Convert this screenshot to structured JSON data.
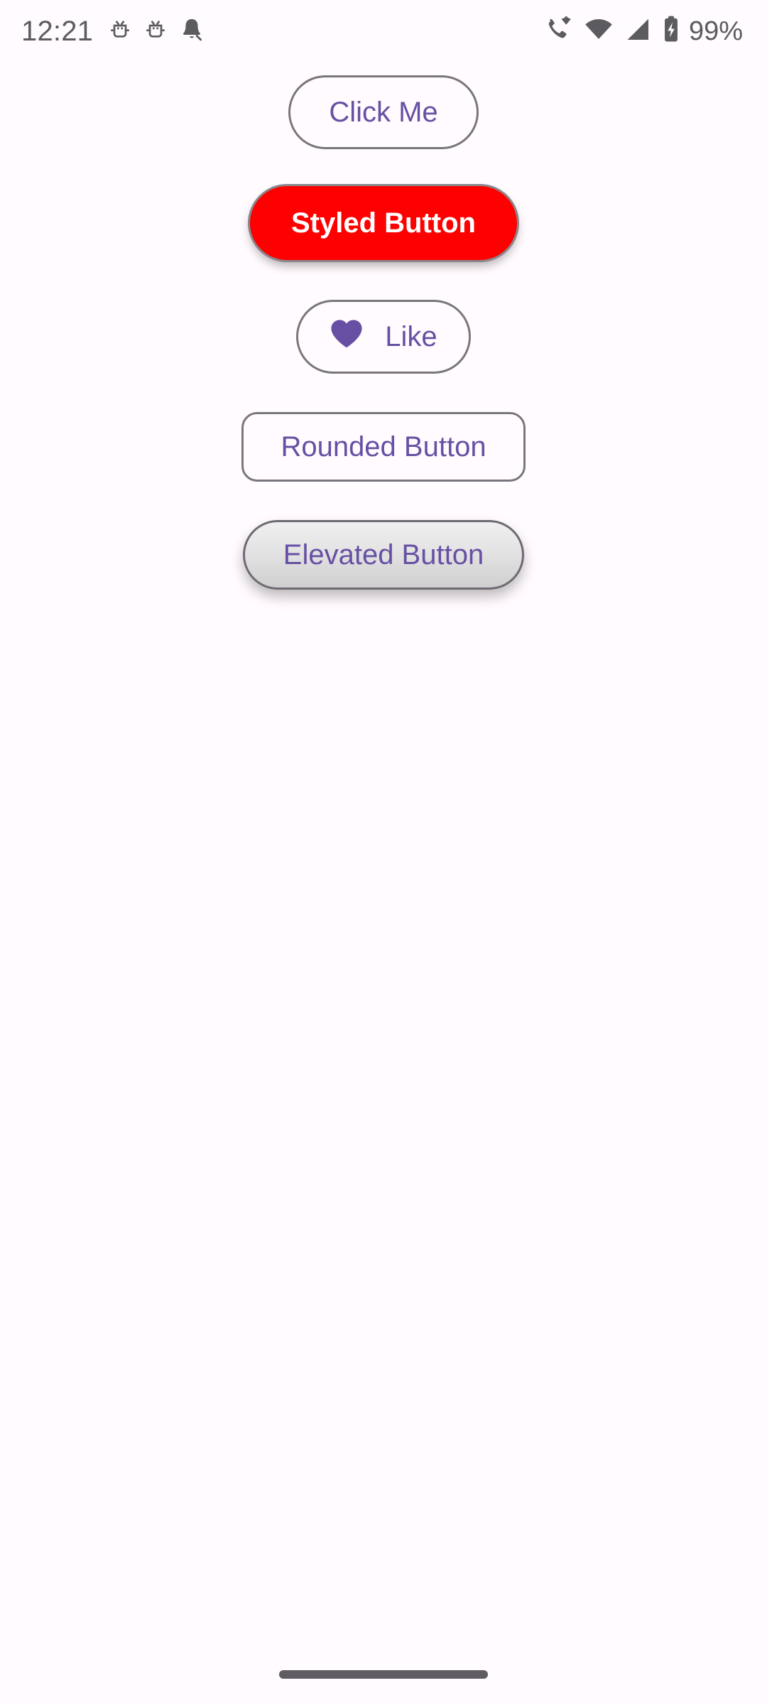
{
  "status_bar": {
    "time": "12:21",
    "left_icons": [
      {
        "name": "android-debug-icon-1"
      },
      {
        "name": "android-debug-icon-2"
      },
      {
        "name": "notification-bell-icon"
      }
    ],
    "right_icons": [
      {
        "name": "vowifi-calling-icon"
      },
      {
        "name": "wifi-icon"
      },
      {
        "name": "cellular-signal-icon"
      },
      {
        "name": "battery-charging-icon"
      }
    ],
    "battery_percent": "99%",
    "icon_color": "#5B5B60"
  },
  "theme": {
    "background": "#FFFBFE",
    "primary_purple": "#6750A4",
    "outline_gray": "#7A767E",
    "accent_red": "#FF0000",
    "nav_pill": "#5F5C62"
  },
  "buttons": [
    {
      "id": "click-me",
      "label": "Click Me",
      "style": "outlined-pill",
      "text_color": "#6750A4",
      "border_color": "#7A767E"
    },
    {
      "id": "styled",
      "label": "Styled Button",
      "style": "filled-pill-elevated",
      "background": "#FF0000",
      "text_color": "#FFFFFF"
    },
    {
      "id": "like",
      "label": "Like",
      "icon": "heart-icon",
      "icon_color": "#6750A4",
      "style": "outlined-pill-with-icon",
      "text_color": "#6750A4",
      "border_color": "#7A767E"
    },
    {
      "id": "rounded",
      "label": "Rounded Button",
      "style": "outlined-rounded-rect",
      "text_color": "#6750A4",
      "border_color": "#7A767E"
    },
    {
      "id": "elevated",
      "label": "Elevated Button",
      "style": "elevated-gradient-pill",
      "text_color": "#6750A4",
      "border_color": "#6E6A72"
    }
  ],
  "navigation": {
    "gesture_pill": "home-gesture-pill"
  }
}
